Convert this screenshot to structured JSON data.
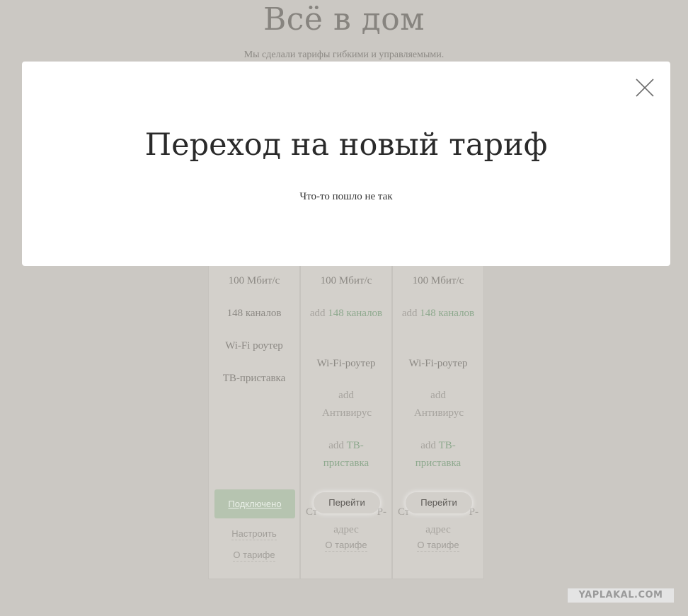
{
  "header": {
    "title": "Всё в дом",
    "subtitle": "Мы сделали тарифы гибкими и управляемыми."
  },
  "tariffs": [
    {
      "speed": "100 Мбит/с",
      "channels": "148 каналов",
      "router": "Wi-Fi роутер",
      "tv_box": "ТВ-приставка",
      "connected_label": "Подключено",
      "configure_link": "Настроить",
      "about_link": "О тарифе"
    },
    {
      "speed": "100 Мбит/с",
      "add_alt": "add",
      "channels": "148 каналов",
      "router": "Wi-Fi-роутер",
      "antivirus": "Антивирус",
      "tv_box": "ТВ-приставка",
      "static_ip_prefix": "Ст",
      "static_ip_suffix": "Р-",
      "static_ip_line2": "адрес",
      "go_label": "Перейти",
      "about_link": "О тарифе"
    },
    {
      "speed": "100 Мбит/с",
      "add_alt": "add",
      "channels": "148 каналов",
      "router": "Wi-Fi-роутер",
      "antivirus": "Антивирус",
      "tv_box": "ТВ-приставка",
      "static_ip_prefix": "Ст",
      "static_ip_suffix": "Р-",
      "static_ip_line2": "адрес",
      "go_label": "Перейти",
      "about_link": "О тарифе"
    }
  ],
  "modal": {
    "title": "Переход на новый тариф",
    "message": "Что-то пошло не так",
    "close_icon": "close-icon"
  },
  "watermark": "YAPLAKAL.COM",
  "colors": {
    "backdrop": "#cbc8c3",
    "modal_bg": "#ffffff",
    "accent_green": "#8ea98e"
  }
}
